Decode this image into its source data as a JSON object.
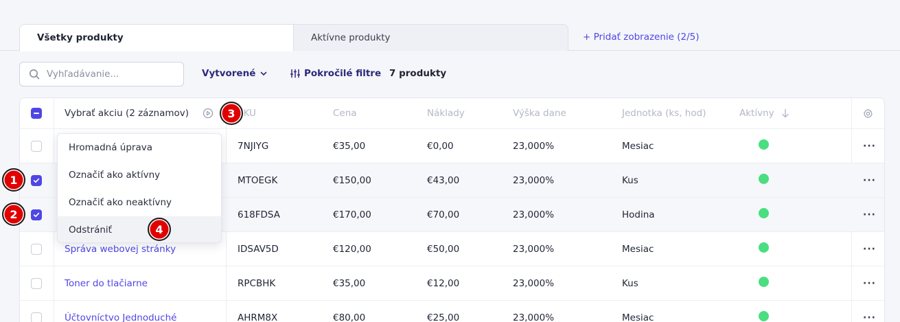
{
  "tabs": [
    {
      "label": "Všetky produkty"
    },
    {
      "label": "Aktívne produkty"
    }
  ],
  "add_view_label": "+ Pridať zobrazenie (2/5)",
  "toolbar": {
    "search_placeholder": "Vyhľadávanie...",
    "created_label": "Vytvorené",
    "filters_label": "Pokročilé filtre",
    "count_label": "7 produkty"
  },
  "table": {
    "action_select_label": "Vybrať akciu (2 záznamov)",
    "columns": [
      "SKU",
      "Cena",
      "Náklady",
      "Výška dane",
      "Jednotka (ks, hod)",
      "Aktívny"
    ],
    "rows": [
      {
        "name": "",
        "sku": "7NJIYG",
        "price": "€35,00",
        "cost": "€0,00",
        "tax": "23,000%",
        "unit": "Mesiac",
        "checked": false
      },
      {
        "name": "",
        "sku": "MTOEGK",
        "price": "€150,00",
        "cost": "€43,00",
        "tax": "23,000%",
        "unit": "Kus",
        "checked": true
      },
      {
        "name": "",
        "sku": "618FDSA",
        "price": "€170,00",
        "cost": "€70,00",
        "tax": "23,000%",
        "unit": "Hodina",
        "checked": true
      },
      {
        "name": "Správa webovej stránky",
        "sku": "IDSAV5D",
        "price": "€120,00",
        "cost": "€50,00",
        "tax": "23,000%",
        "unit": "Mesiac",
        "checked": false
      },
      {
        "name": "Toner do tlačiarne",
        "sku": "RPCBHK",
        "price": "€35,00",
        "cost": "€12,00",
        "tax": "23,000%",
        "unit": "Kus",
        "checked": false
      },
      {
        "name": "Účtovníctvo Jednoduché",
        "sku": "AHRM8X",
        "price": "€80,00",
        "cost": "€25,00",
        "tax": "23,000%",
        "unit": "Mesiac",
        "checked": false
      }
    ]
  },
  "action_menu": [
    "Hromadná úprava",
    "Označiť ako aktívny",
    "Označiť ako neaktívny",
    "Odstrániť"
  ],
  "markers": [
    "1",
    "2",
    "3",
    "4"
  ],
  "colors": {
    "accent": "#4f46e5",
    "active_dot": "#4ade80",
    "marker": "#e00000"
  }
}
